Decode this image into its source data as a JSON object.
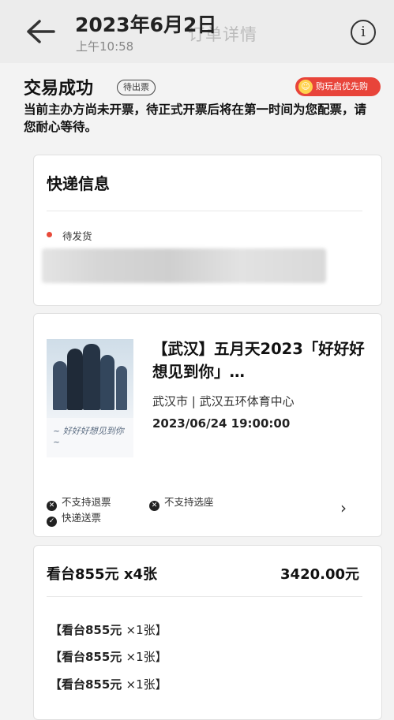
{
  "header": {
    "title": "2023年6月2日",
    "time": "上午10:58",
    "behind_title": "订单详情",
    "info_icon": "info-icon"
  },
  "status": {
    "title": "交易成功",
    "badge": "待出票",
    "promo": "购玩启优先购",
    "notice": "当前主办方尚未开票，待正式开票后将在第一时间为您配票，请您耐心等待。"
  },
  "delivery": {
    "title": "快递信息",
    "status": "待发货",
    "status_color": "#e84a3a"
  },
  "event": {
    "title": "【武汉】五月天2023「好好好想见到你」…",
    "venue": "武汉市 | 武汉五环体育中心",
    "datetime": "2023/06/24  19:00:00",
    "tags": [
      {
        "icon": "x-circle-icon",
        "label": "不支持退票"
      },
      {
        "icon": "x-circle-icon",
        "label": "不支持选座"
      },
      {
        "icon": "check-circle-icon",
        "label": "快递送票"
      }
    ]
  },
  "order": {
    "summary": "看台855元 x4张",
    "total": "3420.00元",
    "tickets": [
      {
        "seat": "【看台855元",
        "qty": "×1张】"
      },
      {
        "seat": "【看台855元",
        "qty": "×1张】"
      },
      {
        "seat": "【看台855元",
        "qty": "×1张】"
      }
    ]
  }
}
